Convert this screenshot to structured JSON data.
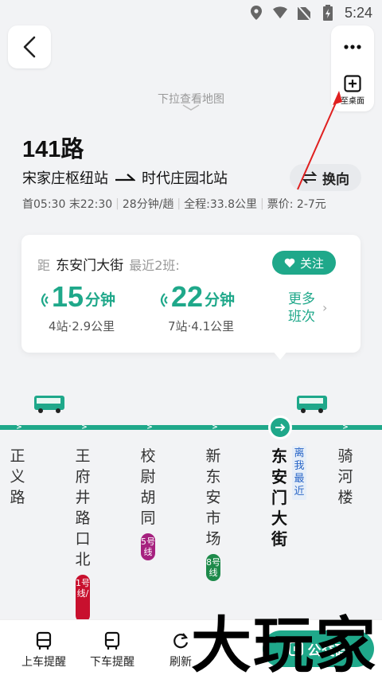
{
  "status_bar": {
    "time": "5:24"
  },
  "header": {
    "pull_hint": "下拉查看地图",
    "desktop_label": "至桌面"
  },
  "route": {
    "number": "141",
    "suffix": "路",
    "from": "宋家庄枢纽站",
    "to": "时代庄园北站",
    "swap_label": "换向",
    "first_bus": "首05:30",
    "last_bus": "末22:30",
    "interval": "28分钟/趟",
    "length": "全程:33.8公里",
    "fare": "票价: 2-7元"
  },
  "arrival_card": {
    "prefix": "距",
    "station": "东安门大街",
    "nearest_label": "最近2班:",
    "follow_label": "关注",
    "buses": [
      {
        "eta_number": "15",
        "eta_unit": "分钟",
        "detail": "4站·2.9公里"
      },
      {
        "eta_number": "22",
        "eta_unit": "分钟",
        "detail": "7站·4.1公里"
      }
    ],
    "more_label_line1": "更多",
    "more_label_line2": "班次"
  },
  "stops": [
    {
      "name": "正义路"
    },
    {
      "name": "王府井路口北",
      "metro": "1号线/"
    },
    {
      "name": "校尉胡同",
      "metro": "5号线"
    },
    {
      "name": "新东安市场",
      "metro": "8号线"
    },
    {
      "name": "东安门大街",
      "current": true
    },
    {
      "name": "骑河楼"
    }
  ],
  "near_tag": "离我最近",
  "bottom_bar": {
    "board_reminder": "上车提醒",
    "alight_reminder": "下车提醒",
    "refresh": "刷新",
    "bus_code": "公交码"
  },
  "watermark": "大玩家",
  "colors": {
    "accent": "#1fa88a",
    "metro_line1": "#c8102e",
    "metro_line5": "#a6217f",
    "metro_line8": "#1d8a4a",
    "annotation_red": "#e02020"
  }
}
